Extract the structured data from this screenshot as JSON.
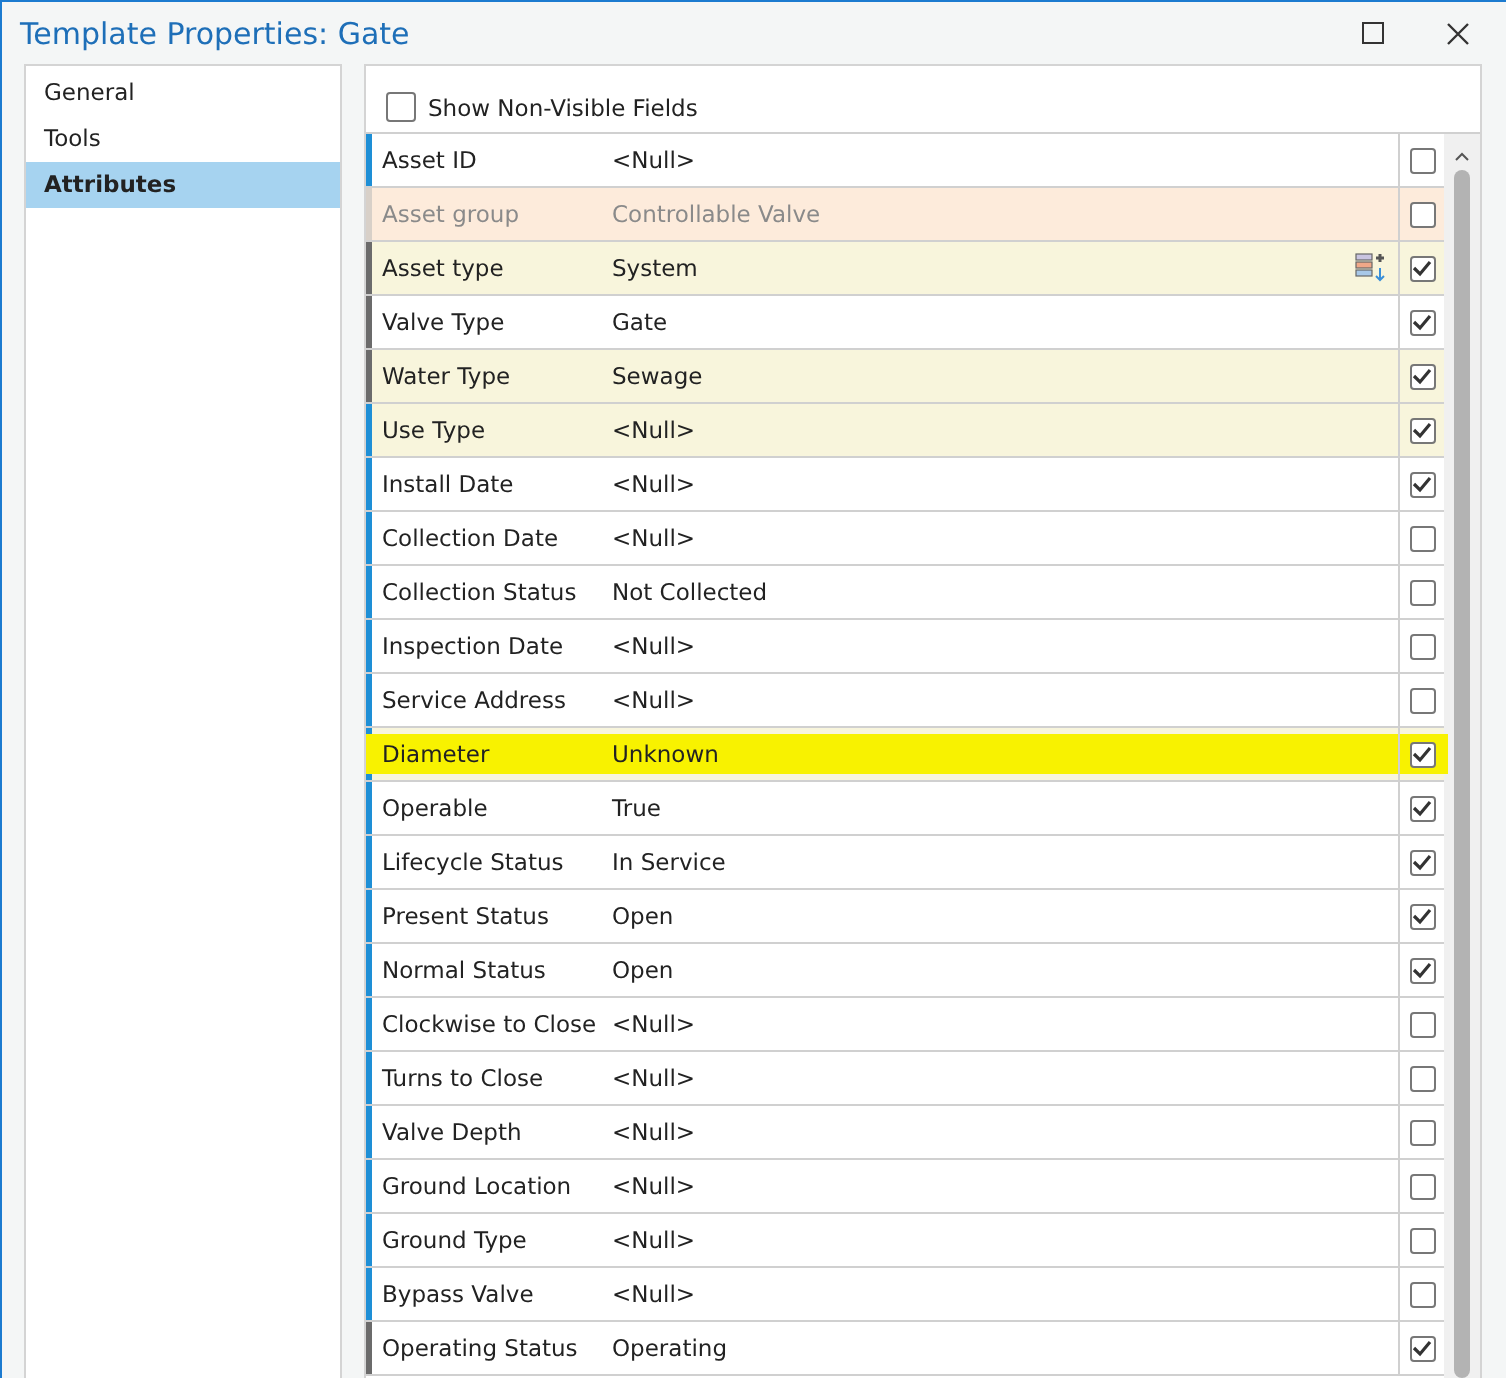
{
  "window": {
    "title": "Template Properties: Gate"
  },
  "sidebar": {
    "items": [
      {
        "label": "General",
        "selected": false
      },
      {
        "label": "Tools",
        "selected": false
      },
      {
        "label": "Attributes",
        "selected": true
      }
    ]
  },
  "show_non_visible": {
    "label": "Show Non-Visible Fields",
    "checked": false
  },
  "rows": [
    {
      "field": "Asset ID",
      "value": "<Null>",
      "kind": "normal",
      "color": "#1e8fd6",
      "checked": false,
      "highlighted": false,
      "has_icon": false
    },
    {
      "field": "Asset group",
      "value": "Controllable Valve",
      "kind": "disabled",
      "color": "#d8d0c8",
      "checked": false,
      "highlighted": false,
      "has_icon": false
    },
    {
      "field": "Asset type",
      "value": "System",
      "kind": "required",
      "color": "#6b6b6b",
      "checked": true,
      "highlighted": false,
      "has_icon": true
    },
    {
      "field": "Valve Type",
      "value": "Gate",
      "kind": "normal",
      "color": "#6b6b6b",
      "checked": true,
      "highlighted": false,
      "has_icon": false
    },
    {
      "field": "Water Type",
      "value": "Sewage",
      "kind": "required",
      "color": "#6b6b6b",
      "checked": true,
      "highlighted": false,
      "has_icon": false
    },
    {
      "field": "Use Type",
      "value": "<Null>",
      "kind": "required",
      "color": "#1e8fd6",
      "checked": true,
      "highlighted": false,
      "has_icon": false
    },
    {
      "field": "Install Date",
      "value": "<Null>",
      "kind": "normal",
      "color": "#1e8fd6",
      "checked": true,
      "highlighted": false,
      "has_icon": false
    },
    {
      "field": "Collection Date",
      "value": "<Null>",
      "kind": "normal",
      "color": "#1e8fd6",
      "checked": false,
      "highlighted": false,
      "has_icon": false
    },
    {
      "field": "Collection Status",
      "value": "Not Collected",
      "kind": "normal",
      "color": "#1e8fd6",
      "checked": false,
      "highlighted": false,
      "has_icon": false
    },
    {
      "field": "Inspection Date",
      "value": "<Null>",
      "kind": "normal",
      "color": "#1e8fd6",
      "checked": false,
      "highlighted": false,
      "has_icon": false
    },
    {
      "field": "Service Address",
      "value": "<Null>",
      "kind": "normal",
      "color": "#1e8fd6",
      "checked": false,
      "highlighted": false,
      "has_icon": false
    },
    {
      "field": "Diameter",
      "value": "Unknown",
      "kind": "required",
      "color": "#1e8fd6",
      "checked": true,
      "highlighted": true,
      "has_icon": false
    },
    {
      "field": "Operable",
      "value": "True",
      "kind": "normal",
      "color": "#1e8fd6",
      "checked": true,
      "highlighted": false,
      "has_icon": false
    },
    {
      "field": "Lifecycle Status",
      "value": "In Service",
      "kind": "normal",
      "color": "#1e8fd6",
      "checked": true,
      "highlighted": false,
      "has_icon": false
    },
    {
      "field": "Present Status",
      "value": "Open",
      "kind": "normal",
      "color": "#1e8fd6",
      "checked": true,
      "highlighted": false,
      "has_icon": false
    },
    {
      "field": "Normal Status",
      "value": "Open",
      "kind": "normal",
      "color": "#1e8fd6",
      "checked": true,
      "highlighted": false,
      "has_icon": false
    },
    {
      "field": "Clockwise to Close",
      "value": "<Null>",
      "kind": "normal",
      "color": "#1e8fd6",
      "checked": false,
      "highlighted": false,
      "has_icon": false
    },
    {
      "field": "Turns to Close",
      "value": "<Null>",
      "kind": "normal",
      "color": "#1e8fd6",
      "checked": false,
      "highlighted": false,
      "has_icon": false
    },
    {
      "field": "Valve Depth",
      "value": "<Null>",
      "kind": "normal",
      "color": "#1e8fd6",
      "checked": false,
      "highlighted": false,
      "has_icon": false
    },
    {
      "field": "Ground Location",
      "value": "<Null>",
      "kind": "normal",
      "color": "#1e8fd6",
      "checked": false,
      "highlighted": false,
      "has_icon": false
    },
    {
      "field": "Ground Type",
      "value": "<Null>",
      "kind": "normal",
      "color": "#1e8fd6",
      "checked": false,
      "highlighted": false,
      "has_icon": false
    },
    {
      "field": "Bypass Valve",
      "value": "<Null>",
      "kind": "normal",
      "color": "#1e8fd6",
      "checked": false,
      "highlighted": false,
      "has_icon": false
    },
    {
      "field": "Operating Status",
      "value": "Operating",
      "kind": "normal",
      "color": "#6b6b6b",
      "checked": true,
      "highlighted": false,
      "has_icon": false
    }
  ]
}
